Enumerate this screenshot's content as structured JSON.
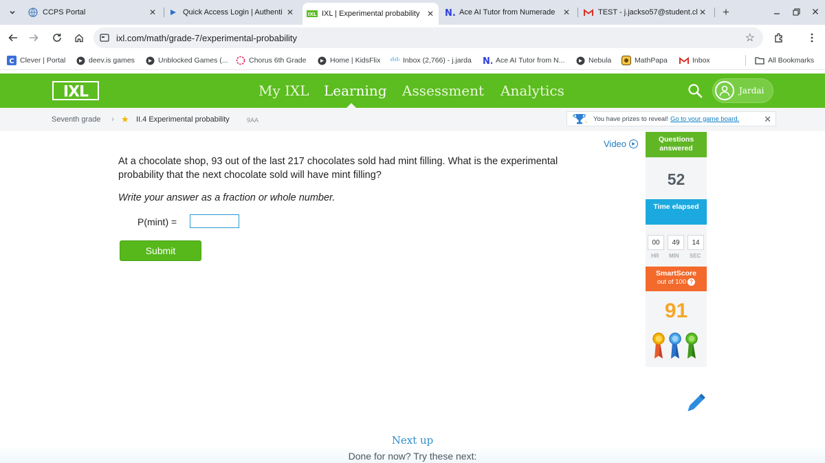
{
  "browser": {
    "tabs": [
      {
        "title": "CCPS Portal",
        "active": false
      },
      {
        "title": "Quick Access Login | Authenti",
        "active": false
      },
      {
        "title": "IXL | Experimental probability",
        "active": true
      },
      {
        "title": "Ace AI Tutor from Numerade",
        "active": false
      },
      {
        "title": "TEST - j.jackso57@student.cl",
        "active": false
      }
    ],
    "url": "ixl.com/math/grade-7/experimental-probability",
    "bookmarks": [
      "Clever | Portal",
      "deev.is games",
      "Unblocked Games (...",
      "Chorus 6th Grade",
      "Home | KidsFlix",
      "Inbox (2,766) - j.jarda",
      "Ace AI Tutor from N...",
      "Nebula",
      "MathPapa",
      "Inbox"
    ],
    "all_bookmarks": "All Bookmarks"
  },
  "ixl": {
    "logo": "IXL",
    "nav": [
      "My IXL",
      "Learning",
      "Assessment",
      "Analytics"
    ],
    "active_nav": "Learning",
    "user": "Jardai",
    "brand_green": "#5bbd1f"
  },
  "breadcrumb": {
    "grade": "Seventh grade",
    "skill": "II.4 Experimental probability",
    "code": "9AA"
  },
  "prize": {
    "text": "You have prizes to reveal!",
    "link": "Go to your game board."
  },
  "question": {
    "video": "Video",
    "text": "At a chocolate shop, 93 out of the last 217 chocolates sold had mint filling. What is the experimental probability that the next chocolate sold will have mint filling?",
    "instruction": "Write your answer as a fraction or whole number.",
    "label": "P(mint) =",
    "answer_value": "",
    "submit": "Submit"
  },
  "sidebar": {
    "questions_label": "Questions answered",
    "questions_answered": "52",
    "time_label": "Time elapsed",
    "time": {
      "hr": "00",
      "min": "49",
      "sec": "14"
    },
    "time_units": {
      "hr": "HR",
      "min": "MIN",
      "sec": "SEC"
    },
    "smartscore_label": "SmartScore",
    "smartscore_sub": "out of 100",
    "smartscore": "91"
  },
  "footer": {
    "next_up": "Next up",
    "done": "Done for now? Try these next:"
  }
}
